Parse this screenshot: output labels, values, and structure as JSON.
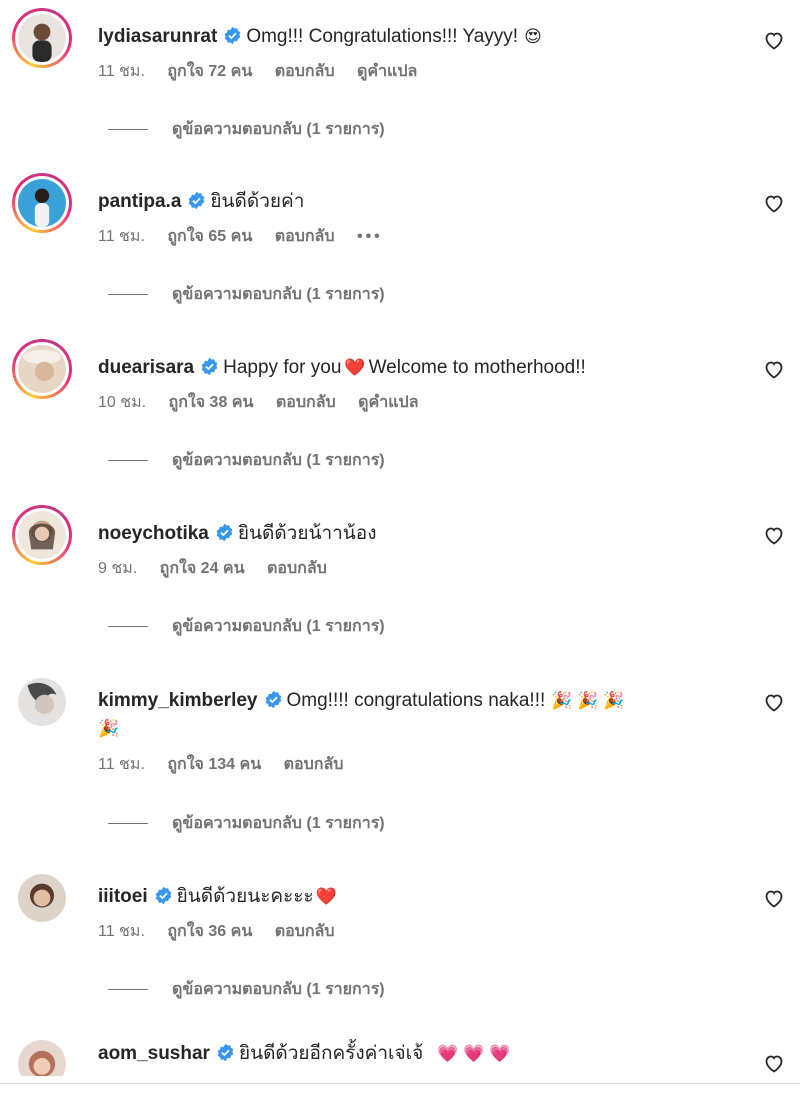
{
  "comments": [
    {
      "username": "lydiasarunrat",
      "text": "Omg!!! Congratulations!!! Yayyy!",
      "emoji": "😍",
      "time": "11 ชม.",
      "likes": "ถูกใจ 72 คน",
      "reply": "ตอบกลับ",
      "extra": "ดูคำแปล",
      "view_replies": "ดูข้อความตอบกลับ (1 รายการ)",
      "avatar_color": "#6b4a3a"
    },
    {
      "username": "pantipa.a",
      "text": "ยินดีด้วยค่า",
      "emoji": "",
      "time": "11 ชม.",
      "likes": "ถูกใจ 65 คน",
      "reply": "ตอบกลับ",
      "extra": "•••",
      "view_replies": "ดูข้อความตอบกลับ (1 รายการ)",
      "avatar_color": "#3aa0d8"
    },
    {
      "username": "duearisara",
      "text": "Happy for you",
      "emoji": "❤️",
      "text2": "Welcome to motherhood!!",
      "time": "10 ชม.",
      "likes": "ถูกใจ 38 คน",
      "reply": "ตอบกลับ",
      "extra": "ดูคำแปล",
      "view_replies": "ดูข้อความตอบกลับ (1 รายการ)",
      "avatar_color": "#d9b79a"
    },
    {
      "username": "noeychotika",
      "text": "ยินดีด้วยน้าาน้อง",
      "emoji": "",
      "time": "9 ชม.",
      "likes": "ถูกใจ 24 คน",
      "reply": "ตอบกลับ",
      "extra": "",
      "view_replies": "ดูข้อความตอบกลับ (1 รายการ)",
      "avatar_color": "#c9a48d"
    },
    {
      "username": "kimmy_kimberley",
      "text": "Omg!!!! congratulations naka!!!",
      "emoji": "🎉 🎉 🎉",
      "emoji2": "🎉",
      "time": "11 ชม.",
      "likes": "ถูกใจ 134 คน",
      "reply": "ตอบกลับ",
      "extra": "",
      "view_replies": "ดูข้อความตอบกลับ (1 รายการ)",
      "avatar_color": "#b7b2ad"
    },
    {
      "username": "iiitoei",
      "text": "ยินดีด้วยนะคะะะ",
      "emoji": "❤️",
      "time": "11 ชม.",
      "likes": "ถูกใจ 36 คน",
      "reply": "ตอบกลับ",
      "extra": "",
      "view_replies": "ดูข้อความตอบกลับ (1 รายการ)",
      "avatar_color": "#a27d67"
    },
    {
      "username": "aom_sushar",
      "text": "ยินดีด้วยอีกครั้งค่าเจ่เจ้",
      "emoji": "💗 💗 💗",
      "time": "",
      "likes": "",
      "reply": "",
      "extra": "",
      "view_replies": "",
      "avatar_color": "#c98d7a"
    }
  ]
}
